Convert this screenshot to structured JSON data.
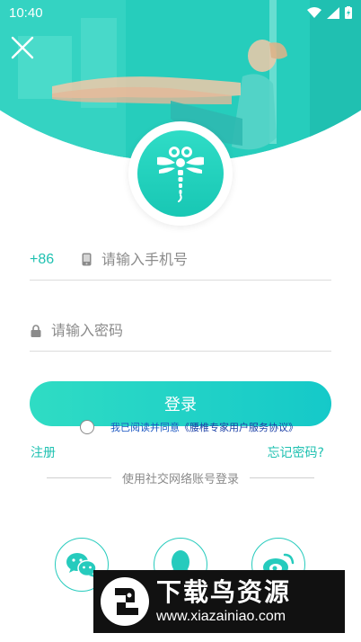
{
  "status_bar": {
    "time": "10:40"
  },
  "colors": {
    "accent": "#1fc1b1",
    "banner": "#2fd8c4",
    "link_blue": "#1b3fa6"
  },
  "icons": {
    "close": "close-icon",
    "logo": "dragonfly-logo-icon",
    "phone": "phone-icon",
    "lock": "lock-icon",
    "wechat": "wechat-icon",
    "qq": "qq-icon",
    "weibo": "weibo-icon"
  },
  "form": {
    "country_code": "+86",
    "phone_placeholder": "请输入手机号",
    "password_placeholder": "请输入密码",
    "login_label": "登录",
    "agree_prefix": "我已阅读并同意",
    "agree_link": "《腰椎专家用户服务协议》"
  },
  "links": {
    "register": "注册",
    "forgot": "忘记密码?"
  },
  "social": {
    "divider_text": "使用社交网络账号登录"
  },
  "watermark": {
    "title": "下载鸟资源",
    "url": "www.xiazainiao.com"
  }
}
